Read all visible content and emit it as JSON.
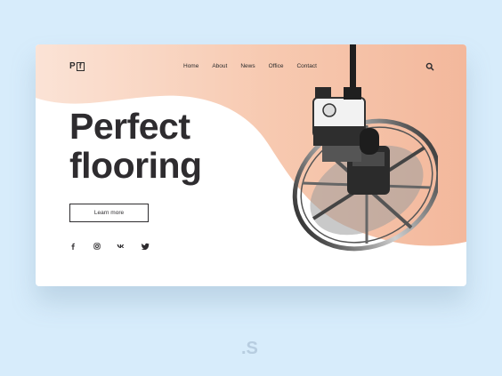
{
  "brand": {
    "logo_left": "P",
    "logo_right": "f"
  },
  "nav": {
    "items": [
      {
        "label": "Home"
      },
      {
        "label": "About"
      },
      {
        "label": "News"
      },
      {
        "label": "Office"
      },
      {
        "label": "Contact"
      }
    ]
  },
  "hero": {
    "title_line1": "Perfect",
    "title_line2": "flooring",
    "cta_label": "Learn more"
  },
  "socials": [
    "facebook-icon",
    "instagram-icon",
    "vk-icon",
    "twitter-icon"
  ],
  "colors": {
    "accent_peach": "#f6c7ad",
    "text_dark": "#2e2c2f",
    "page_bg": "#d7ecfb"
  },
  "watermark": ".S"
}
